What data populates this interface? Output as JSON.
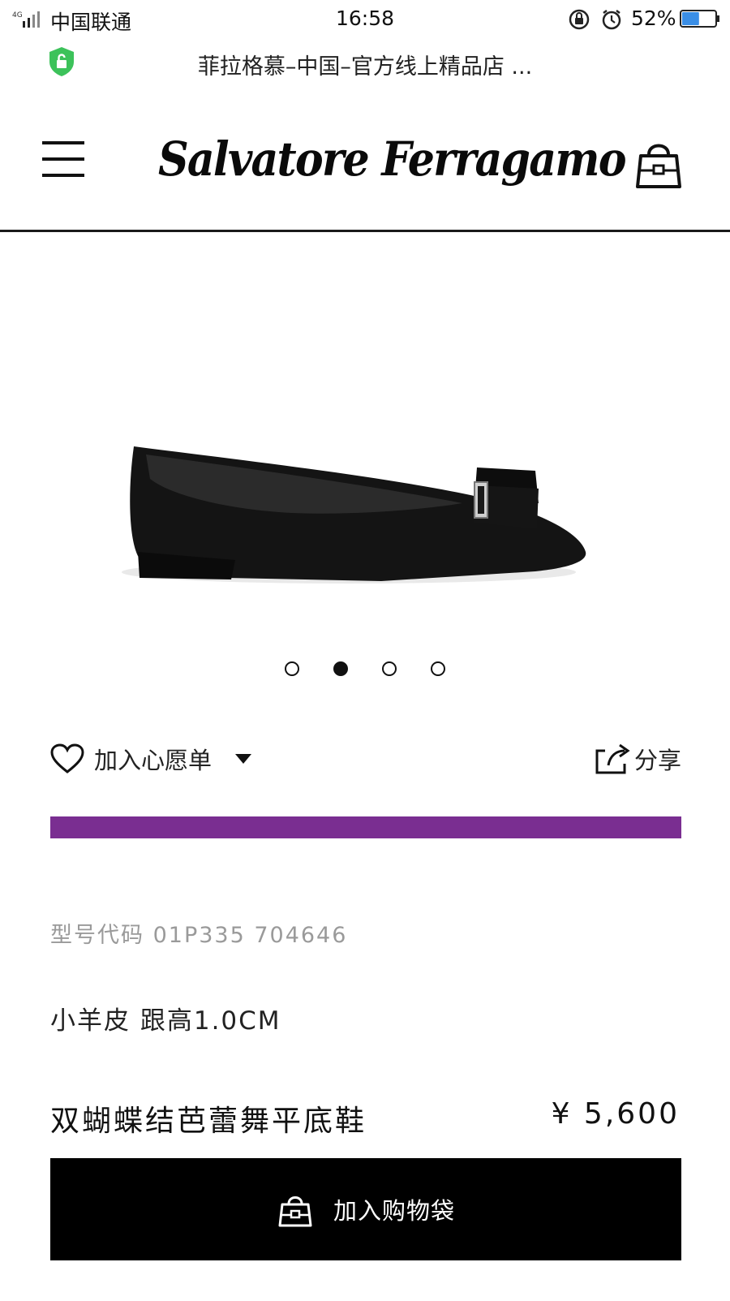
{
  "status_bar": {
    "network": "4G",
    "carrier": "中国联通",
    "time": "16:58",
    "battery_percent": "52%",
    "battery_level": 0.52
  },
  "url_bar": {
    "page_title": "菲拉格慕–中国–官方线上精品店 ...",
    "secure_icon": "shield-lock-icon",
    "secure_color": "#3cc25a"
  },
  "header": {
    "brand": "Salvatore Ferragamo",
    "menu_icon": "hamburger-menu-icon",
    "bag_icon": "shopping-bag-icon"
  },
  "carousel": {
    "slide_count": 4,
    "active_index": 1
  },
  "actions": {
    "wishlist_label": "加入心愿单",
    "share_label": "分享"
  },
  "colors": {
    "accent_bar": "#7a2e91",
    "button_bg": "#000000"
  },
  "product": {
    "model_code": "型号代码 01P335 704646",
    "material": "小羊皮 跟高1.0CM",
    "name": "双蝴蝶结芭蕾舞平底鞋",
    "price": "¥ 5,600"
  },
  "cta": {
    "add_to_bag_label": "加入购物袋"
  }
}
